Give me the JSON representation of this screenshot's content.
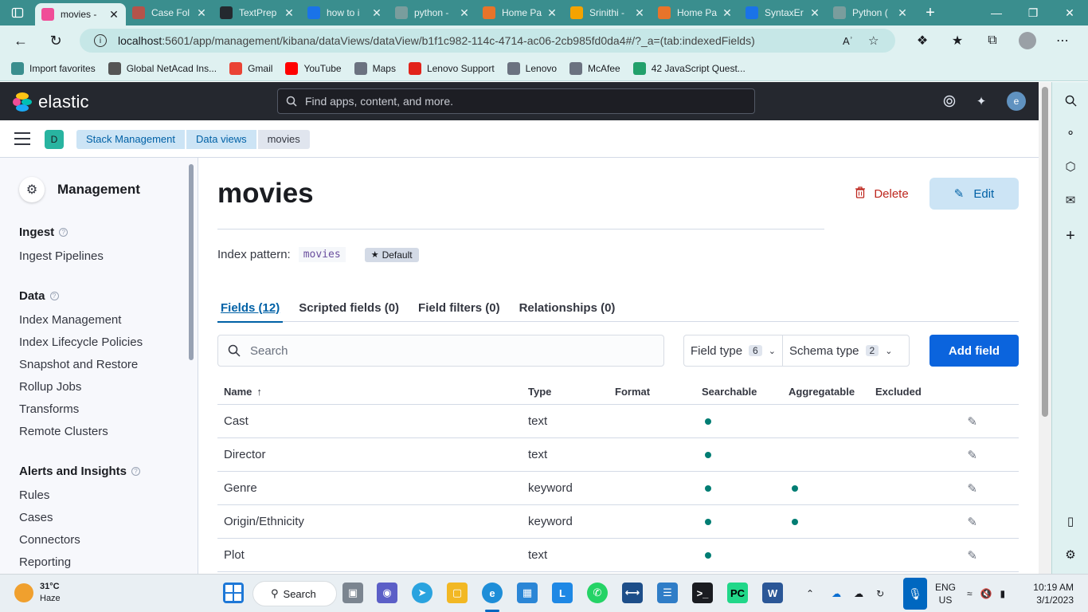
{
  "browser": {
    "tabs": [
      {
        "title": "movies - ",
        "active": true,
        "fav_color": "#f04e98"
      },
      {
        "title": "Case Fol",
        "active": false,
        "fav_color": "#b5534a"
      },
      {
        "title": "TextPrep",
        "active": false,
        "fav_color": "#24292f"
      },
      {
        "title": "how to i",
        "active": false,
        "fav_color": "#1a73e8"
      },
      {
        "title": "python -",
        "active": false,
        "fav_color": "#7a9d9d"
      },
      {
        "title": "Home Pa",
        "active": false,
        "fav_color": "#e8742a"
      },
      {
        "title": "Srinithi -",
        "active": false,
        "fav_color": "#f4a300"
      },
      {
        "title": "Home Pa",
        "active": false,
        "fav_color": "#e8742a"
      },
      {
        "title": "SyntaxEr",
        "active": false,
        "fav_color": "#1a73e8"
      },
      {
        "title": "Python (",
        "active": false,
        "fav_color": "#7a9d9d"
      }
    ],
    "url_host": "localhost",
    "url_rest": ":5601/app/management/kibana/dataViews/dataView/b1f1c982-114c-4714-ac06-2cb985fd0da4#/?_a=(tab:indexedFields)",
    "favorites": [
      {
        "label": "Import favorites",
        "icon_color": "#3a8e8e"
      },
      {
        "label": "Global NetAcad Ins...",
        "icon_color": "#555"
      },
      {
        "label": "Gmail",
        "icon_color": "#ea4335"
      },
      {
        "label": "YouTube",
        "icon_color": "#ff0000"
      },
      {
        "label": "Maps",
        "icon_color": "#6b7280"
      },
      {
        "label": "Lenovo Support",
        "icon_color": "#e2231a"
      },
      {
        "label": "Lenovo",
        "icon_color": "#6b7280"
      },
      {
        "label": "McAfee",
        "icon_color": "#6b7280"
      },
      {
        "label": "42 JavaScript Quest...",
        "icon_color": "#22a06b"
      }
    ]
  },
  "kibana": {
    "logo_text": "elastic",
    "search_placeholder": "Find apps, content, and more.",
    "user_initial": "e",
    "space_initial": "D",
    "breadcrumbs": [
      "Stack Management",
      "Data views",
      "movies"
    ]
  },
  "sidebar": {
    "title": "Management",
    "groups": [
      {
        "label": "Ingest",
        "items": [
          "Ingest Pipelines"
        ]
      },
      {
        "label": "Data",
        "items": [
          "Index Management",
          "Index Lifecycle Policies",
          "Snapshot and Restore",
          "Rollup Jobs",
          "Transforms",
          "Remote Clusters"
        ]
      },
      {
        "label": "Alerts and Insights",
        "items": [
          "Rules",
          "Cases",
          "Connectors",
          "Reporting"
        ]
      }
    ]
  },
  "main": {
    "title": "movies",
    "delete_label": "Delete",
    "edit_label": "Edit",
    "index_pattern_label": "Index pattern:",
    "index_pattern_value": "movies",
    "default_badge": "Default",
    "tabs": [
      "Fields (12)",
      "Scripted fields (0)",
      "Field filters (0)",
      "Relationships (0)"
    ],
    "search_placeholder": "Search",
    "field_type_label": "Field type",
    "field_type_count": "6",
    "schema_type_label": "Schema type",
    "schema_type_count": "2",
    "add_field_label": "Add field",
    "columns": [
      "Name",
      "Type",
      "Format",
      "Searchable",
      "Aggregatable",
      "Excluded"
    ],
    "rows": [
      {
        "name": "Cast",
        "type": "text",
        "searchable": true,
        "aggregatable": false
      },
      {
        "name": "Director",
        "type": "text",
        "searchable": true,
        "aggregatable": false
      },
      {
        "name": "Genre",
        "type": "keyword",
        "searchable": true,
        "aggregatable": true
      },
      {
        "name": "Origin/Ethnicity",
        "type": "keyword",
        "searchable": true,
        "aggregatable": true
      },
      {
        "name": "Plot",
        "type": "text",
        "searchable": true,
        "aggregatable": false
      }
    ]
  },
  "taskbar": {
    "temperature": "31°C",
    "weather": "Haze",
    "search_label": "Search",
    "lang_line1": "ENG",
    "lang_line2": "US",
    "time": "10:19 AM",
    "date": "3/1/2023"
  }
}
